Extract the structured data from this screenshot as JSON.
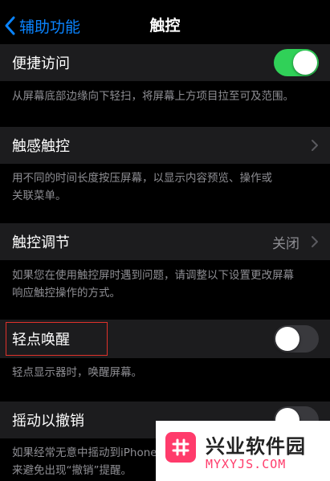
{
  "nav": {
    "back_label": "辅助功能",
    "title": "触控"
  },
  "sections": {
    "reachability": {
      "label": "便捷访问",
      "toggle_state": "on",
      "footer": "从屏幕底部边缘向下轻扫，将屏幕上方项目拉至可及范围。"
    },
    "haptic_touch": {
      "label": "触感触控",
      "footer_line1": "用不同的时间长度按压屏幕，以显示内容预览、操作或",
      "footer_line2": "关联菜单。"
    },
    "touch_accommodations": {
      "label": "触控调节",
      "value": "关闭",
      "footer_line1": "如果您在使用触控屏时遇到问题，请调整以下设置更改屏幕",
      "footer_line2": "响应触控操作的方式。"
    },
    "tap_to_wake": {
      "label": "轻点唤醒",
      "toggle_state": "off",
      "footer": "轻点显示器时，唤醒屏幕。"
    },
    "shake_to_undo": {
      "label": "摇动以撤销",
      "toggle_state": "off",
      "footer_line1": "如果经常无意中摇动到iPhone，",
      "footer_line2": "来避免出现“撤销”提醒。"
    }
  },
  "watermark": {
    "logo_icon": "hash-grid-icon",
    "title": "兴业软件园",
    "subtitle": "MYXYJS.COM"
  },
  "colors": {
    "accent": "#0a84ff",
    "toggle_on": "#30d158",
    "highlight": "#e0322b",
    "watermark_brand": "#ff3b6b"
  }
}
